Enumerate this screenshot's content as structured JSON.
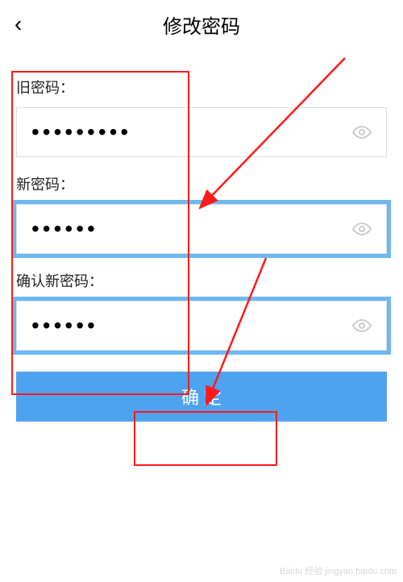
{
  "header": {
    "title": "修改密码",
    "back_icon": "‹"
  },
  "fields": {
    "old": {
      "label": "旧密码：",
      "value": "•••••••••"
    },
    "new": {
      "label": "新密码：",
      "value": "••••••"
    },
    "confirm": {
      "label": "确认新密码：",
      "value": "••••••"
    }
  },
  "submit_label": "确 定",
  "watermark": "Baidu 经验  jingyan.baidu.com"
}
